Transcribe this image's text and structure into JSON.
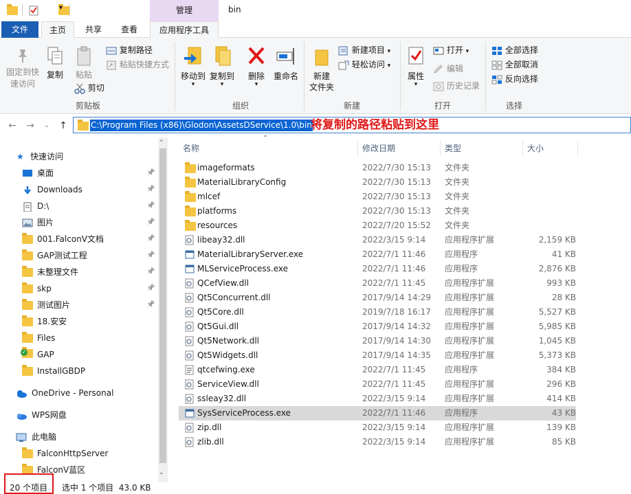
{
  "window": {
    "title": "bin",
    "context_tab_group": "管理"
  },
  "ribbon_tabs": {
    "file": "文件",
    "home": "主页",
    "share": "共享",
    "view": "查看",
    "app_tools": "应用程序工具"
  },
  "clipboard": {
    "pin_quick_access": "固定到快\n速访问",
    "copy": "复制",
    "paste": "粘贴",
    "copy_path": "复制路径",
    "paste_shortcut": "粘贴快捷方式",
    "cut": "剪切",
    "group": "剪贴板"
  },
  "organize": {
    "move_to": "移动到",
    "copy_to": "复制到",
    "delete": "删除",
    "rename": "重命名",
    "group": "组织"
  },
  "new": {
    "new_folder": "新建\n文件夹",
    "new_item": "新建项目",
    "easy_access": "轻松访问",
    "group": "新建"
  },
  "open": {
    "properties": "属性",
    "open": "打开",
    "edit": "编辑",
    "history": "历史记录",
    "group": "打开"
  },
  "select": {
    "select_all": "全部选择",
    "select_none": "全部取消",
    "invert": "反向选择",
    "group": "选择"
  },
  "address": {
    "path": "C:\\Program Files (x86)\\Glodon\\AssetsDService\\1.0\\bin"
  },
  "annotation": "将复制的路径粘贴到这里",
  "nav": {
    "quick_access": "快速访问",
    "items": [
      {
        "label": "桌面",
        "icon": "desktop-icon",
        "pinned": true
      },
      {
        "label": "Downloads",
        "icon": "download-icon",
        "pinned": true
      },
      {
        "label": "D:\\",
        "icon": "document-icon",
        "pinned": true
      },
      {
        "label": "图片",
        "icon": "pictures-icon",
        "pinned": true
      },
      {
        "label": "001.FalconV文档",
        "icon": "folder-icon",
        "pinned": true
      },
      {
        "label": "GAP测试工程",
        "icon": "folder-icon",
        "pinned": true
      },
      {
        "label": "未整理文件",
        "icon": "folder-icon",
        "pinned": true
      },
      {
        "label": "skp",
        "icon": "folder-icon",
        "pinned": true
      },
      {
        "label": "测试图片",
        "icon": "folder-icon",
        "pinned": true
      },
      {
        "label": "18.安安",
        "icon": "folder-icon",
        "pinned": false
      },
      {
        "label": "Files",
        "icon": "folder-icon",
        "pinned": false
      },
      {
        "label": "GAP",
        "icon": "folder-check-icon",
        "pinned": false
      },
      {
        "label": "InstallGBDP",
        "icon": "folder-icon",
        "pinned": false
      }
    ],
    "onedrive": "OneDrive - Personal",
    "wps": "WPS网盘",
    "this_pc": "此电脑",
    "pc_items": [
      "FalconHttpServer",
      "FalconV蓝区"
    ]
  },
  "columns": {
    "name": "名称",
    "date": "修改日期",
    "type": "类型",
    "size": "大小"
  },
  "files": [
    {
      "name": "imageformats",
      "date": "2022/7/30 15:13",
      "type": "文件夹",
      "size": "",
      "icon": "folder-icon"
    },
    {
      "name": "MaterialLibraryConfig",
      "date": "2022/7/30 15:13",
      "type": "文件夹",
      "size": "",
      "icon": "folder-icon"
    },
    {
      "name": "mlcef",
      "date": "2022/7/30 15:13",
      "type": "文件夹",
      "size": "",
      "icon": "folder-icon"
    },
    {
      "name": "platforms",
      "date": "2022/7/30 15:13",
      "type": "文件夹",
      "size": "",
      "icon": "folder-icon"
    },
    {
      "name": "resources",
      "date": "2022/7/20 15:52",
      "type": "文件夹",
      "size": "",
      "icon": "folder-icon"
    },
    {
      "name": "libeay32.dll",
      "date": "2022/3/15 9:14",
      "type": "应用程序扩展",
      "size": "2,159 KB",
      "icon": "dll-icon"
    },
    {
      "name": "MaterialLibraryServer.exe",
      "date": "2022/7/1 11:46",
      "type": "应用程序",
      "size": "41 KB",
      "icon": "exe-icon"
    },
    {
      "name": "MLServiceProcess.exe",
      "date": "2022/7/1 11:46",
      "type": "应用程序",
      "size": "2,876 KB",
      "icon": "exe-icon"
    },
    {
      "name": "QCefView.dll",
      "date": "2022/7/1 11:45",
      "type": "应用程序扩展",
      "size": "993 KB",
      "icon": "dll-icon"
    },
    {
      "name": "Qt5Concurrent.dll",
      "date": "2017/9/14 14:29",
      "type": "应用程序扩展",
      "size": "28 KB",
      "icon": "dll-icon"
    },
    {
      "name": "Qt5Core.dll",
      "date": "2019/7/18 16:17",
      "type": "应用程序扩展",
      "size": "5,527 KB",
      "icon": "dll-icon"
    },
    {
      "name": "Qt5Gui.dll",
      "date": "2017/9/14 14:32",
      "type": "应用程序扩展",
      "size": "5,985 KB",
      "icon": "dll-icon"
    },
    {
      "name": "Qt5Network.dll",
      "date": "2017/9/14 14:30",
      "type": "应用程序扩展",
      "size": "1,045 KB",
      "icon": "dll-icon"
    },
    {
      "name": "Qt5Widgets.dll",
      "date": "2017/9/14 14:35",
      "type": "应用程序扩展",
      "size": "5,373 KB",
      "icon": "dll-icon"
    },
    {
      "name": "qtcefwing.exe",
      "date": "2022/7/1 11:45",
      "type": "应用程序",
      "size": "384 KB",
      "icon": "exe-doc-icon"
    },
    {
      "name": "ServiceView.dll",
      "date": "2022/7/1 11:45",
      "type": "应用程序扩展",
      "size": "296 KB",
      "icon": "dll-icon"
    },
    {
      "name": "ssleay32.dll",
      "date": "2022/3/15 9:14",
      "type": "应用程序扩展",
      "size": "414 KB",
      "icon": "dll-icon"
    },
    {
      "name": "SysServiceProcess.exe",
      "date": "2022/7/1 11:46",
      "type": "应用程序",
      "size": "43 KB",
      "icon": "exe-icon",
      "selected": true
    },
    {
      "name": "zip.dll",
      "date": "2022/3/15 9:14",
      "type": "应用程序扩展",
      "size": "139 KB",
      "icon": "dll-icon"
    },
    {
      "name": "zlib.dll",
      "date": "2022/3/15 9:14",
      "type": "应用程序扩展",
      "size": "85 KB",
      "icon": "dll-icon"
    }
  ],
  "status": {
    "count": "20 个项目",
    "selection": "选中 1 个项目  43.0 KB"
  },
  "colors": {
    "accent": "#1a5fb4",
    "annotation": "#e01818",
    "selection_bg": "#d9d9d9",
    "context_tab": "#e8d8f2"
  }
}
